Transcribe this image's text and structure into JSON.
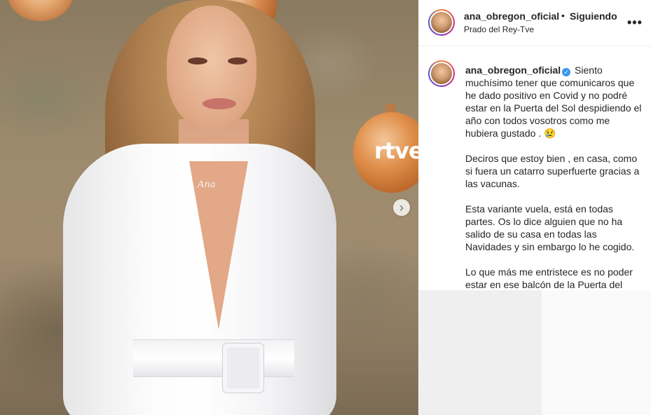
{
  "post": {
    "username": "ana_obregon_oficial",
    "separator": "•",
    "follow_status": "Siguiendo",
    "location": "Prado del Rey-Tve",
    "more_icon": "more-options-icon"
  },
  "photo": {
    "ornament_text": "rtve",
    "necklace_text": "Ana",
    "next_icon": "chevron-right-icon"
  },
  "caption": {
    "username": "ana_obregon_oficial",
    "verified_icon": "verified-badge-icon",
    "para1": "Siento muchísimo tener que comunicaros que he dado positivo en Covid y no podré estar en la Puerta del Sol despidiendo el año con todos vosotros como me hubiera gustado . 😢",
    "para2": "Deciros que estoy bien , en casa, como si fuera un catarro superfuerte gracias a las vacunas.",
    "para3": "Esta variante vuela, está en todas partes. Os lo dice alguien que no ha salido de su casa en todas las Navidades y sin embargo lo he cogido.",
    "para4": "Lo que más me entristece es no poder estar en ese balcón de la Puerta del"
  }
}
